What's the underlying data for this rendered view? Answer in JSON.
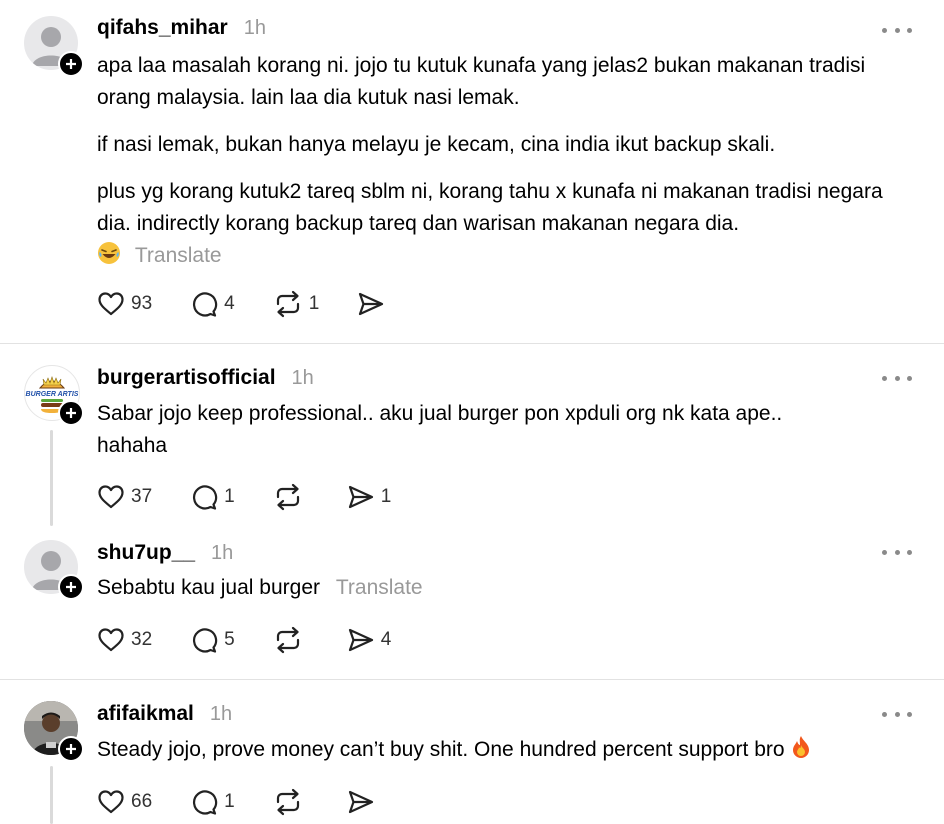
{
  "posts": [
    {
      "username": "qifahs_mihar",
      "time": "1h",
      "paragraphs": [
        "apa laa masalah korang ni. jojo tu kutuk kunafa yang jelas2 bukan makanan tradisi orang malaysia. lain laa dia kutuk nasi lemak.",
        "if nasi lemak, bukan hanya melayu je kecam, cina india ikut backup skali.",
        "plus yg korang kutuk2 tareq sblm ni, korang tahu x kunafa ni makanan tradisi negara dia. indirectly korang backup tareq dan warisan makanan negara dia."
      ],
      "translate": "Translate",
      "likes": "93",
      "replies": "4",
      "reposts": "1",
      "shares": ""
    },
    {
      "username": "burgerartisofficial",
      "time": "1h",
      "text": "Sabar jojo keep professional.. aku jual burger pon xpduli org nk kata ape.. hahaha",
      "likes": "37",
      "replies": "1",
      "reposts": "",
      "shares": "1",
      "avatar_text": "BURGER ARTIS"
    },
    {
      "username": "shu7up__",
      "time": "1h",
      "text": "Sebabtu kau jual burger",
      "translate": "Translate",
      "likes": "32",
      "replies": "5",
      "reposts": "",
      "shares": "4"
    },
    {
      "username": "afifaikmal",
      "time": "1h",
      "text": "Steady jojo, prove money can’t buy shit. One hundred percent support bro",
      "likes": "66",
      "replies": "1",
      "reposts": "",
      "shares": ""
    }
  ],
  "colors": {
    "secondary_text": "#999999",
    "divider": "#e2e2e2"
  },
  "icons": [
    "heart-icon",
    "comment-icon",
    "repost-icon",
    "share-icon",
    "more-icon",
    "follow-plus-icon",
    "laughing-emoji",
    "fire-emoji"
  ]
}
